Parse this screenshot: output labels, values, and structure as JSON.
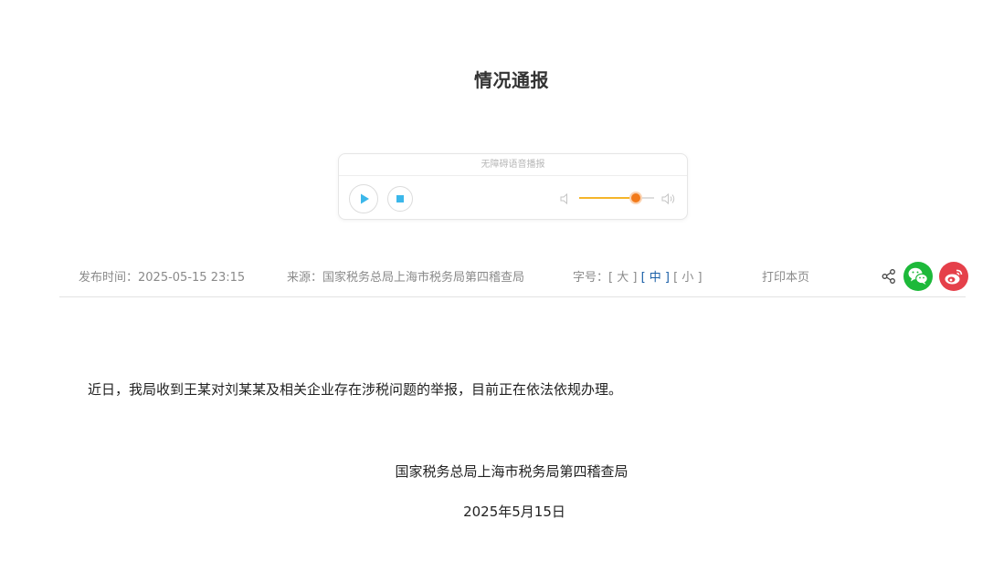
{
  "article": {
    "title": "情况通报",
    "body": "近日，我局收到王某对刘某某及相关企业存在涉税问题的举报，目前正在依法依规办理。",
    "signature_org": "国家税务总局上海市税务局第四稽查局",
    "signature_date": "2025年5月15日"
  },
  "player": {
    "header": "无障碍语音播报",
    "volume_level": 0.76,
    "colors": {
      "button_icon": "#3bb7ea",
      "volume_fill": "#f5b52a",
      "volume_knob": "#f27a1a"
    }
  },
  "meta": {
    "publish_label": "发布时间：",
    "publish_time": "2025-05-15 23:15",
    "source_label": "来源：",
    "source": "国家税务总局上海市税务局第四稽查局",
    "font_label": "字号：",
    "font_large": "[ 大 ]",
    "font_medium": "[ 中 ]",
    "font_small": "[ 小 ]",
    "font_selected": "中",
    "print_label": "打印本页"
  },
  "share": {
    "icons": [
      "share-icon",
      "wechat-icon",
      "weibo-icon"
    ],
    "colors": {
      "wechat": "#1db93a",
      "weibo": "#e5404a",
      "font_active": "#1a5fa7"
    }
  }
}
